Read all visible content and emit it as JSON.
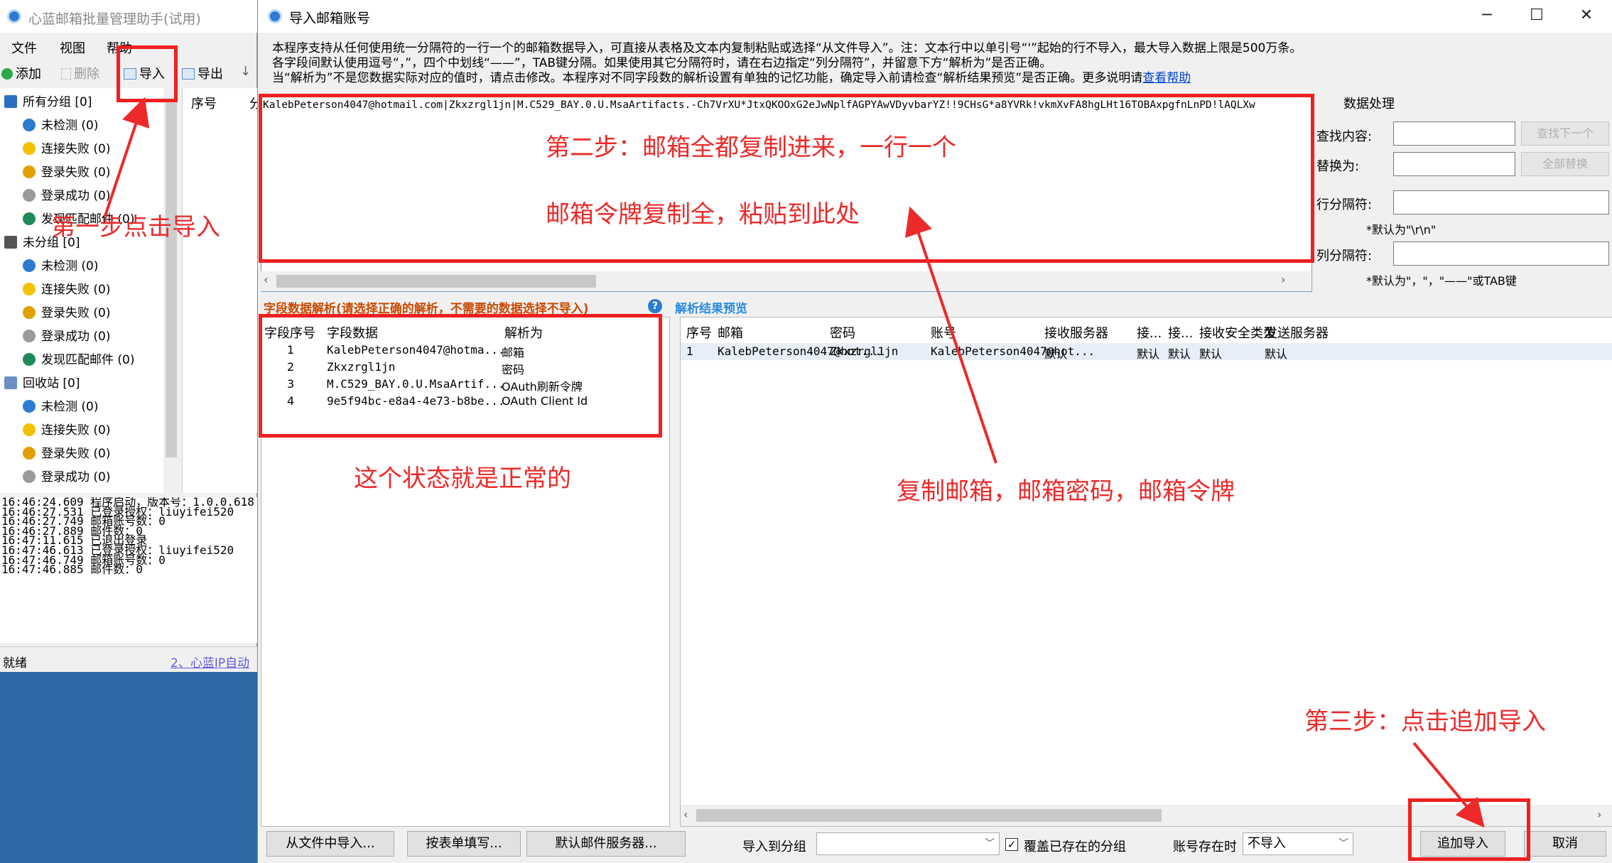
{
  "main_window": {
    "title": "心蓝邮箱批量管理助手(试用)",
    "menu": [
      "文件",
      "视图",
      "帮助"
    ],
    "toolbar": {
      "add": "添加",
      "delete": "删除",
      "import": "导入",
      "export": "导出",
      "sort": "↓"
    },
    "tree": [
      {
        "label": "所有分组 [0]",
        "level": 0,
        "icon": "group-icon",
        "color": "#2b6fc0"
      },
      {
        "label": "未检测 (0)",
        "level": 1,
        "icon": "uncheck-icon",
        "color": "#2b7bd0"
      },
      {
        "label": "连接失败 (0)",
        "level": 1,
        "icon": "connect-fail-icon",
        "color": "#f2c200"
      },
      {
        "label": "登录失败 (0)",
        "level": 1,
        "icon": "login-fail-icon",
        "color": "#e0a000"
      },
      {
        "label": "登录成功 (0)",
        "level": 1,
        "icon": "login-success-icon",
        "color": "#9a9a9a"
      },
      {
        "label": "发现匹配邮件 (0)",
        "level": 1,
        "icon": "match-mail-icon",
        "color": "#1f8a5a"
      },
      {
        "label": "未分组 [0]",
        "level": 0,
        "icon": "users-icon",
        "color": "#555555"
      },
      {
        "label": "未检测 (0)",
        "level": 1,
        "icon": "uncheck-icon",
        "color": "#2b7bd0"
      },
      {
        "label": "连接失败 (0)",
        "level": 1,
        "icon": "connect-fail-icon",
        "color": "#f2c200"
      },
      {
        "label": "登录失败 (0)",
        "level": 1,
        "icon": "login-fail-icon",
        "color": "#e0a000"
      },
      {
        "label": "登录成功 (0)",
        "level": 1,
        "icon": "login-success-icon",
        "color": "#9a9a9a"
      },
      {
        "label": "发现匹配邮件 (0)",
        "level": 1,
        "icon": "match-mail-icon",
        "color": "#1f8a5a"
      },
      {
        "label": "回收站 [0]",
        "level": 0,
        "icon": "recycle-icon",
        "color": "#6a8fc0"
      },
      {
        "label": "未检测 (0)",
        "level": 1,
        "icon": "uncheck-icon",
        "color": "#2b7bd0"
      },
      {
        "label": "连接失败 (0)",
        "level": 1,
        "icon": "connect-fail-icon",
        "color": "#f2c200"
      },
      {
        "label": "登录失败 (0)",
        "level": 1,
        "icon": "login-fail-icon",
        "color": "#e0a000"
      },
      {
        "label": "登录成功 (0)",
        "level": 1,
        "icon": "login-success-icon",
        "color": "#9a9a9a"
      },
      {
        "label": "发现匹配邮件 (0)",
        "level": 1,
        "icon": "match-mail-icon",
        "color": "#1f8a5a"
      }
    ],
    "list_headers": [
      "序号",
      "分"
    ],
    "log": [
      "16:46:24.609 程序启动，版本号：1.0.0.618",
      "16:46:27.531 已登录授权：liuyifei520",
      "16:46:27.749 邮箱账号数：0",
      "16:46:27.889 邮件数：0",
      "16:47:11.615 已退出登录",
      "16:47:46.613 已登录授权：liuyifei520",
      "16:47:46.749 邮箱账号数：0",
      "16:47:46.885 邮件数：0"
    ],
    "status": "就绪",
    "status_link": "2、心蓝IP自动"
  },
  "dialog": {
    "title": "导入邮箱账号",
    "notice": [
      "本程序支持从任何使用统一分隔符的一行一个的邮箱数据导入，可直接从表格及文本内复制粘贴或选择“从文件导入”。注：文本行中以单引号“'”起始的行不导入，最大导入数据上限是500万条。",
      "各字段间默认使用逗号“，”，四个中划线“——”，TAB键分隔。如果使用其它分隔符时，请在右边指定“列分隔符”，并留意下方“解析为”是否正确。",
      "当“解析为”不是您数据实际对应的值时，请点击修改。本程序对不同字段数的解析设置有单独的记忆功能，确定导入前请检查“解析结果预览”是否正确。更多说明请"
    ],
    "help_link": "查看帮助",
    "paste_text": "KalebPeterson4047@hotmail.com|Zkxzrgl1jn|M.C529_BAY.0.U.MsaArtifacts.-Ch7VrXU*JtxQKOOxG2eJwNplfAGPYAwVDyvbarYZ!!9CHsG*a8YVRk!vkmXvFA8hgLHt16TOBAxpgfnLnPD!lAQLXw",
    "processing": {
      "header": "数据处理",
      "find_label": "查找内容:",
      "find_value": "",
      "find_next_button": "查找下一个",
      "replace_label": "替换为:",
      "replace_value": "",
      "replace_all_button": "全部替换",
      "row_sep_label": "行分隔符:",
      "row_sep_value": "",
      "row_sep_note": "*默认为\"\\r\\n\"",
      "col_sep_label": "列分隔符:",
      "col_sep_value": "",
      "col_sep_note": "*默认为\"，\"，\"——\"或TAB键"
    },
    "field_section_title": "字段数据解析(请选择正确的解析，不需要的数据选择不导入)",
    "preview_section_title": "解析结果预览",
    "field_headers": [
      "字段序号",
      "字段数据",
      "解析为"
    ],
    "fields": [
      {
        "no": "1",
        "data": "KalebPeterson4047@hotma...",
        "parse": "邮箱"
      },
      {
        "no": "2",
        "data": "Zkxzrgl1jn",
        "parse": "密码"
      },
      {
        "no": "3",
        "data": "M.C529_BAY.0.U.MsaArtif...",
        "parse": "OAuth刷新令牌"
      },
      {
        "no": "4",
        "data": "9e5f94bc-e8a4-4e73-b8be...",
        "parse": "OAuth Client Id"
      }
    ],
    "preview_headers": [
      "序号",
      "邮箱",
      "密码",
      "账号",
      "接收服务器",
      "接...",
      "接...",
      "接收安全类型",
      "发送服务器"
    ],
    "preview_rows": [
      [
        "1",
        "KalebPeterson4047@hot...",
        "Zkxzrgl1jn",
        "KalebPeterson4047@hot...",
        "默认",
        "默认",
        "默认",
        "默认",
        "默认"
      ]
    ],
    "bottom": {
      "import_file_button": "从文件中导入...",
      "fill_form_button": "按表单填写...",
      "default_server_button": "默认邮件服务器...",
      "group_label": "导入到分组",
      "group_value": "",
      "overwrite_checked": true,
      "overwrite_label": "覆盖已存在的分组",
      "exists_label": "账号存在时",
      "exists_value": "不导入",
      "append_button": "追加导入",
      "cancel_button": "取消"
    }
  },
  "annotations": {
    "step1": "第一步点击导入",
    "step2_line1": "第二步：邮箱全都复制进来，一行一个",
    "step2_line2": "邮箱令牌复制全，粘贴到此处",
    "normal_state": "这个状态就是正常的",
    "copy_hint": "复制邮箱，邮箱密码，邮箱令牌",
    "step3": "第三步：点击追加导入",
    "color": "#ec2a2a"
  }
}
